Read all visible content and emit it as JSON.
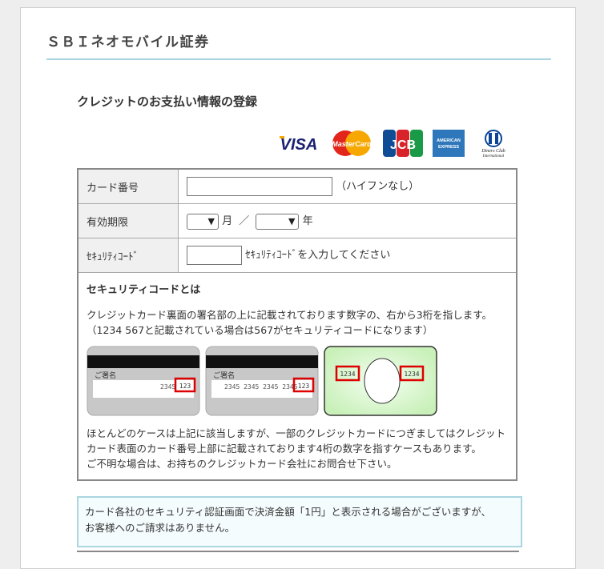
{
  "header": {
    "title": "ＳＢＩネオモバイル証券"
  },
  "page_title": "クレジットのお支払い情報の登録",
  "brands": [
    "VISA",
    "MasterCard",
    "JCB",
    "AMERICAN EXPRESS",
    "Diners Club International"
  ],
  "form": {
    "card_number_label": "カード番号",
    "card_number_hint": "（ハイフンなし）",
    "card_number_value": "",
    "expiry_label": "有効期限",
    "month_unit": "月",
    "separator": "／",
    "year_unit": "年",
    "month_value": "",
    "year_value": "",
    "security_label": "ｾｷｭﾘﾃｨｺｰﾄﾞ",
    "security_hint": "ｾｷｭﾘﾃｨｺｰﾄﾞを入力してください",
    "security_value": ""
  },
  "info": {
    "heading": "セキュリティコードとは",
    "text1": "クレジットカード裏面の署名部の上に記載されております数字の、右から3桁を指します。",
    "text2": "（1234 567と記載されている場合は567がセキュリティコードになります）",
    "card1_sign": "ご署名",
    "card1_digits": "2345",
    "card1_code": "123",
    "card2_sign": "ご署名",
    "card2_digits": "2345 2345 2345 2345",
    "card2_code": "123",
    "card3_left": "1234",
    "card3_right": "1234",
    "text3": "ほとんどのケースは上記に該当しますが、一部のクレジットカードにつぎましてはクレジット",
    "text4": "カード表面のカード番号上部に記載されております4桁の数字を指すケースもあります。",
    "text5": "ご不明な場合は、お持ちのクレジットカード会社にお問合せ下さい。"
  },
  "notice": {
    "line1": "カード各社のセキュリティ認証画面で決済金額「1円」と表示される場合がございますが、",
    "line2": "お客様へのご請求はありません。"
  }
}
